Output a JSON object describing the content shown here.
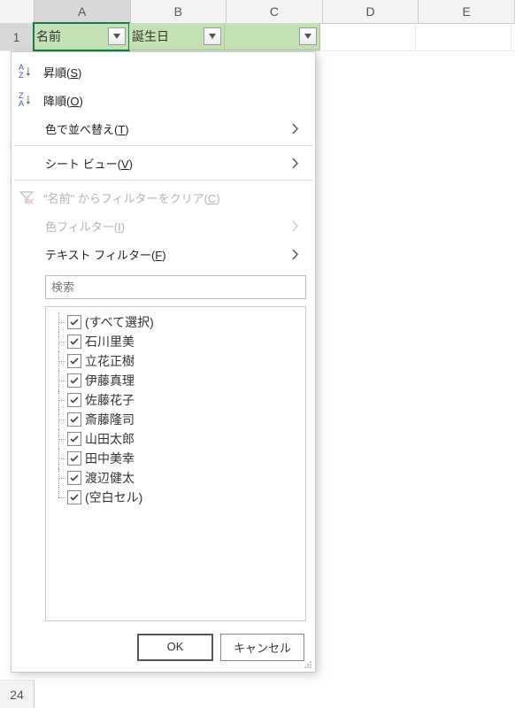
{
  "columns": [
    "A",
    "B",
    "C",
    "D",
    "E"
  ],
  "row1": "1",
  "row24": "24",
  "headers": {
    "a": "名前",
    "b": "誕生日",
    "c": ""
  },
  "popup": {
    "sort_asc": {
      "prefix": "昇順(",
      "accel": "S",
      "suffix": ")"
    },
    "sort_desc": {
      "prefix": "降順(",
      "accel": "O",
      "suffix": ")"
    },
    "sort_color": {
      "prefix": "色で並べ替え(",
      "accel": "T",
      "suffix": ")"
    },
    "sheet_view": {
      "prefix": "シート ビュー(",
      "accel": "V",
      "suffix": ")"
    },
    "clear_filter": {
      "prefix": "\"名前\" からフィルターをクリア(",
      "accel": "C",
      "suffix": ")"
    },
    "color_filter": {
      "prefix": "色フィルター(",
      "accel": "I",
      "suffix": ")"
    },
    "text_filter": {
      "prefix": "テキスト フィルター(",
      "accel": "F",
      "suffix": ")"
    },
    "search_placeholder": "検索",
    "items": [
      "(すべて選択)",
      "石川里美",
      "立花正樹",
      "伊藤真理",
      "佐藤花子",
      "斎藤隆司",
      "山田太郎",
      "田中美幸",
      "渡辺健太",
      "(空白セル)"
    ],
    "ok": "OK",
    "cancel": "キャンセル"
  },
  "icons": {
    "az": "A\nZ",
    "za": "Z\nA"
  }
}
